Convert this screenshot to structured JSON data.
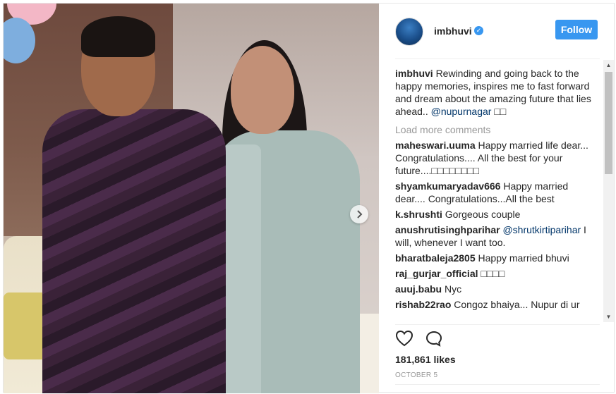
{
  "post": {
    "username": "imbhuvi",
    "follow_label": "Follow",
    "caption_user": "imbhuvi",
    "caption_text": "Rewinding and going back to the happy memories, inspires me to fast forward and dream about the amazing future that lies ahead..",
    "caption_mention": "@nupurnagar",
    "caption_emoji": "□□",
    "load_more": "Load more comments",
    "likes": "181,861 likes",
    "date": "OCTOBER 5"
  },
  "comments": [
    {
      "user": "maheswari.uuma",
      "text": "Happy married life dear... Congratulations.... All the best for your future....□□□□□□□□",
      "mention": "",
      "tail": ""
    },
    {
      "user": "shyamkumaryadav666",
      "text": "Happy married dear.... Congratulations...All the best",
      "mention": "",
      "tail": ""
    },
    {
      "user": "k.shrushti",
      "text": "Gorgeous couple",
      "mention": "",
      "tail": ""
    },
    {
      "user": "anushrutisinghparihar",
      "text": "",
      "mention": "@shrutkirtiparihar",
      "tail": "I will, whenever I want too."
    },
    {
      "user": "bharatbaleja2805",
      "text": "Happy married bhuvi",
      "mention": "",
      "tail": ""
    },
    {
      "user": "raj_gurjar_official",
      "text": "□□□□",
      "mention": "",
      "tail": ""
    },
    {
      "user": "auuj.babu",
      "text": "Nyc",
      "mention": "",
      "tail": ""
    },
    {
      "user": "rishab22rao",
      "text": "Congoz bhaiya... Nupur di ur",
      "mention": "",
      "tail": ""
    }
  ],
  "icons": {
    "verified": "verified-badge-icon",
    "like": "heart-icon",
    "comment": "comment-icon",
    "next": "chevron-right-icon"
  },
  "colors": {
    "accent": "#3897f0",
    "link": "#003569",
    "muted": "#999999"
  }
}
